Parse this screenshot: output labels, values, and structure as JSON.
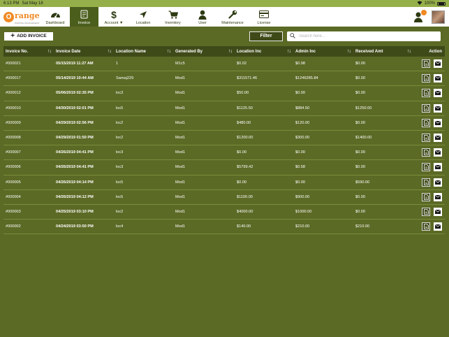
{
  "status_bar": {
    "time": "6:13 PM",
    "date": "Sat May 18",
    "battery": "100%"
  },
  "logo": {
    "text": "range",
    "letter": "O",
    "tagline": "PARKING MANAGEMENT"
  },
  "nav": [
    {
      "label": "Dashboard",
      "icon": "dashboard-icon"
    },
    {
      "label": "Invoice",
      "icon": "invoice-icon"
    },
    {
      "label": "Account ▼",
      "icon": "dollar-icon"
    },
    {
      "label": "Location",
      "icon": "location-arrow-icon"
    },
    {
      "label": "Inventory",
      "icon": "cart-icon"
    },
    {
      "label": "User",
      "icon": "user-icon"
    },
    {
      "label": "Maintenance",
      "icon": "wrench-icon"
    },
    {
      "label": "License",
      "icon": "license-card-icon"
    }
  ],
  "toolbar": {
    "add_label": "ADD INVOICE",
    "filter_label": "Filter",
    "search_placeholder": "Search here..."
  },
  "table": {
    "headers": {
      "no": "Invoice No.",
      "date": "Invoice Date",
      "location": "Location Name",
      "generated": "Generated By",
      "location_inc": "Location Inc",
      "admin_inc": "Admin Inc",
      "received": "Received Amt",
      "action": "Action"
    },
    "sort_glyph": "↑↓",
    "rows": [
      {
        "no": "#000021",
        "date": "05/15/2019 11:27 AM",
        "location": "1",
        "generated": "M1c5",
        "location_inc": "$0.02",
        "admin_inc": "$0.98",
        "received": "$0.00"
      },
      {
        "no": "#000017",
        "date": "05/14/2019 10:44 AM",
        "location": "Samaj229",
        "generated": "Mod1",
        "location_inc": "$311571.46",
        "admin_inc": "$1246285.84",
        "received": "$0.00"
      },
      {
        "no": "#000012",
        "date": "05/06/2019 02:35 PM",
        "location": "loc3",
        "generated": "Mod1",
        "location_inc": "$50.00",
        "admin_inc": "$0.00",
        "received": "$0.00"
      },
      {
        "no": "#000010",
        "date": "04/30/2019 02:01 PM",
        "location": "loc5",
        "generated": "Mod1",
        "location_inc": "$1125.50",
        "admin_inc": "$884.50",
        "received": "$1250.00"
      },
      {
        "no": "#000009",
        "date": "04/29/2019 02:56 PM",
        "location": "loc2",
        "generated": "Mod1",
        "location_inc": "$480.00",
        "admin_inc": "$120.00",
        "received": "$0.00"
      },
      {
        "no": "#000008",
        "date": "04/29/2019 01:50 PM",
        "location": "loc2",
        "generated": "Mod1",
        "location_inc": "$1200.00",
        "admin_inc": "$300.00",
        "received": "$1400.00"
      },
      {
        "no": "#000007",
        "date": "04/26/2019 04:41 PM",
        "location": "loc3",
        "generated": "Mod1",
        "location_inc": "$0.00",
        "admin_inc": "$0.00",
        "received": "$0.00"
      },
      {
        "no": "#000006",
        "date": "04/26/2019 04:41 PM",
        "location": "loc3",
        "generated": "Mod1",
        "location_inc": "$5799.42",
        "admin_inc": "$0.58",
        "received": "$0.00"
      },
      {
        "no": "#000005",
        "date": "04/26/2019 04:14 PM",
        "location": "loc5",
        "generated": "Mod1",
        "location_inc": "$0.00",
        "admin_inc": "$0.00",
        "received": "$590.00"
      },
      {
        "no": "#000004",
        "date": "04/26/2019 04:12 PM",
        "location": "loc5",
        "generated": "Mod1",
        "location_inc": "$1100.00",
        "admin_inc": "$900.00",
        "received": "$0.00"
      },
      {
        "no": "#000003",
        "date": "04/25/2019 03:10 PM",
        "location": "loc2",
        "generated": "Mod1",
        "location_inc": "$4000.00",
        "admin_inc": "$1000.00",
        "received": "$0.00"
      },
      {
        "no": "#000002",
        "date": "04/24/2019 03:50 PM",
        "location": "loc4",
        "generated": "Mod1",
        "location_inc": "$140.00",
        "admin_inc": "$210.00",
        "received": "$210.00"
      }
    ]
  },
  "colors": {
    "background": "#5b6a25",
    "header_row": "#3e4a18",
    "status_bar": "#95b04a",
    "active_nav": "#4b5e1c",
    "accent": "#f08a24"
  }
}
